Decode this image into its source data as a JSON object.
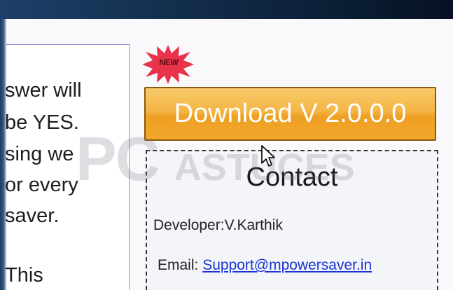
{
  "left_panel": {
    "lines": [
      "swer will",
      "be YES.",
      "sing we",
      "or every",
      "saver.",
      "This"
    ]
  },
  "badge": {
    "label": "NEW"
  },
  "download": {
    "label": "Download V 2.0.0.0"
  },
  "contact": {
    "title": "Contact",
    "developer_label": "Developer:",
    "developer_name": "V.Karthik",
    "email_label": "Email:",
    "email_value": "Support@mpowersaver.in"
  },
  "watermark": {
    "text_large": "PC",
    "text_small": "ASTUCES"
  },
  "colors": {
    "button": "#f4b545",
    "link": "#1a33d6",
    "header": "#0c2038",
    "badge": "#e8334a"
  }
}
